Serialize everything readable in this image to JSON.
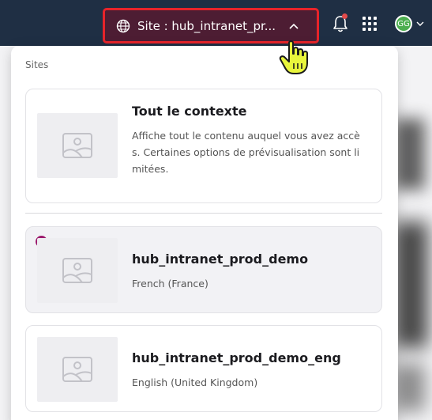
{
  "topbar": {
    "site_label": "Site : hub_intranet_pr...",
    "avatar_initials": "GG",
    "colors": {
      "bar": "#1f2f44",
      "site_button_bg": "#4d1d33",
      "highlight_border": "#e8242a",
      "notification_dot": "#e24b4b",
      "avatar": "#4cae4f"
    },
    "icons": [
      "globe-icon",
      "chevron-up-icon",
      "bell-icon",
      "apps-grid-icon",
      "chevron-down-icon"
    ]
  },
  "dropdown": {
    "title": "Sites",
    "accent_color": "#9c1b6d",
    "sites": [
      {
        "name": "Tout le contexte",
        "description": "Affiche tout le contenu auquel vous avez accès. Certaines options de prévisualisation sont limitées.",
        "selected": false
      },
      {
        "name": "hub_intranet_prod_demo",
        "locale": "French (France)",
        "selected": true
      },
      {
        "name": "hub_intranet_prod_demo_eng",
        "locale": "English (United Kingdom)",
        "selected": false
      }
    ]
  }
}
